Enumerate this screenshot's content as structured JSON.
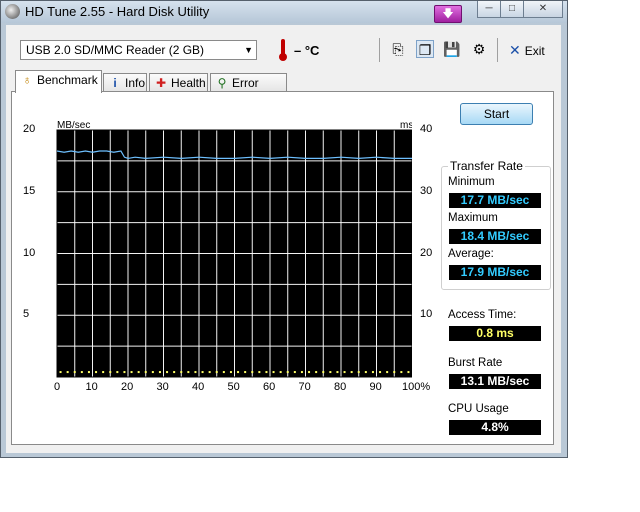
{
  "window": {
    "title": "HD Tune 2.55 - Hard Disk Utility"
  },
  "window_buttons": {
    "minimize": "─",
    "maximize": "□",
    "close": "✕",
    "extra_icon": "down-arrow-icon",
    "extra_glyph": "🡇"
  },
  "toolbar": {
    "drive": "USB 2.0 SD/MMC Reader (2 GB)",
    "dropdown_glyph": "▼",
    "temperature": "– °C",
    "exit_label": "Exit",
    "exit_glyph": "✕",
    "icons": {
      "copy": "⎘",
      "copy_all": "❐",
      "save": "💾",
      "options": "⚙"
    }
  },
  "tabs": [
    {
      "label": "Benchmark",
      "glyph": "♁"
    },
    {
      "label": "Info",
      "glyph": "i"
    },
    {
      "label": "Health",
      "glyph": "✚"
    },
    {
      "label": "Error Scan",
      "glyph": "⚲"
    }
  ],
  "benchmark": {
    "start_label": "Start",
    "transfer_rate_title": "Transfer Rate",
    "minimum_label": "Minimum",
    "minimum_value": "17.7 MB/sec",
    "maximum_label": "Maximum",
    "maximum_value": "18.4 MB/sec",
    "average_label": "Average:",
    "average_value": "17.9 MB/sec",
    "access_time_label": "Access Time:",
    "access_time_value": "0.8 ms",
    "burst_rate_label": "Burst Rate",
    "burst_rate_value": "13.1 MB/sec",
    "cpu_usage_label": "CPU Usage",
    "cpu_usage_value": "4.8%"
  },
  "colors": {
    "transfer_line": "#6ec0ff",
    "access_dots": "#ffff66",
    "grid": "#ffffff",
    "plot_bg": "#000000"
  },
  "chart_data": {
    "type": "line",
    "ylabel": "MB/sec",
    "y2label": "ms",
    "ylim": [
      0,
      20
    ],
    "y2lim": [
      0,
      40
    ],
    "xlim": [
      0,
      100
    ],
    "yticks": [
      "0",
      "5",
      "10",
      "15",
      "20"
    ],
    "y2ticks": [
      "10",
      "20",
      "30",
      "40"
    ],
    "xticks": [
      "0",
      "10",
      "20",
      "30",
      "40",
      "50",
      "60",
      "70",
      "80",
      "90",
      "100%"
    ],
    "grid": true,
    "series": [
      {
        "x": [
          0,
          2,
          4,
          6,
          8,
          10,
          12,
          14,
          16,
          18,
          19,
          20,
          22,
          25,
          30,
          35,
          40,
          45,
          50,
          55,
          60,
          65,
          70,
          75,
          80,
          85,
          90,
          95,
          100
        ],
        "values": [
          18.3,
          18.2,
          18.3,
          18.2,
          18.3,
          18.2,
          18.3,
          18.3,
          18.2,
          18.3,
          17.8,
          17.7,
          17.8,
          17.7,
          17.8,
          17.7,
          17.8,
          17.7,
          17.7,
          17.8,
          17.7,
          17.8,
          17.7,
          17.7,
          17.8,
          17.7,
          17.8,
          17.7,
          17.7
        ]
      },
      {
        "x": [
          1,
          3,
          5,
          7,
          9,
          11,
          13,
          15,
          17,
          19,
          21,
          23,
          25,
          27,
          29,
          31,
          33,
          35,
          37,
          39,
          41,
          43,
          45,
          47,
          49,
          51,
          53,
          55,
          57,
          59,
          61,
          63,
          65,
          67,
          69,
          71,
          73,
          75,
          77,
          79,
          81,
          83,
          85,
          87,
          89,
          91,
          93,
          95,
          97,
          99
        ],
        "values": [
          0.8,
          0.8,
          0.8,
          0.8,
          0.8,
          0.8,
          0.8,
          0.8,
          0.8,
          0.8,
          0.8,
          0.8,
          0.8,
          0.8,
          0.8,
          0.8,
          0.8,
          0.8,
          0.8,
          0.8,
          0.8,
          0.8,
          0.8,
          0.8,
          0.8,
          0.8,
          0.8,
          0.8,
          0.8,
          0.8,
          0.8,
          0.8,
          0.8,
          0.8,
          0.8,
          0.8,
          0.8,
          0.8,
          0.8,
          0.8,
          0.8,
          0.8,
          0.8,
          0.8,
          0.8,
          0.8,
          0.8,
          0.8,
          0.8,
          0.8
        ]
      }
    ]
  }
}
